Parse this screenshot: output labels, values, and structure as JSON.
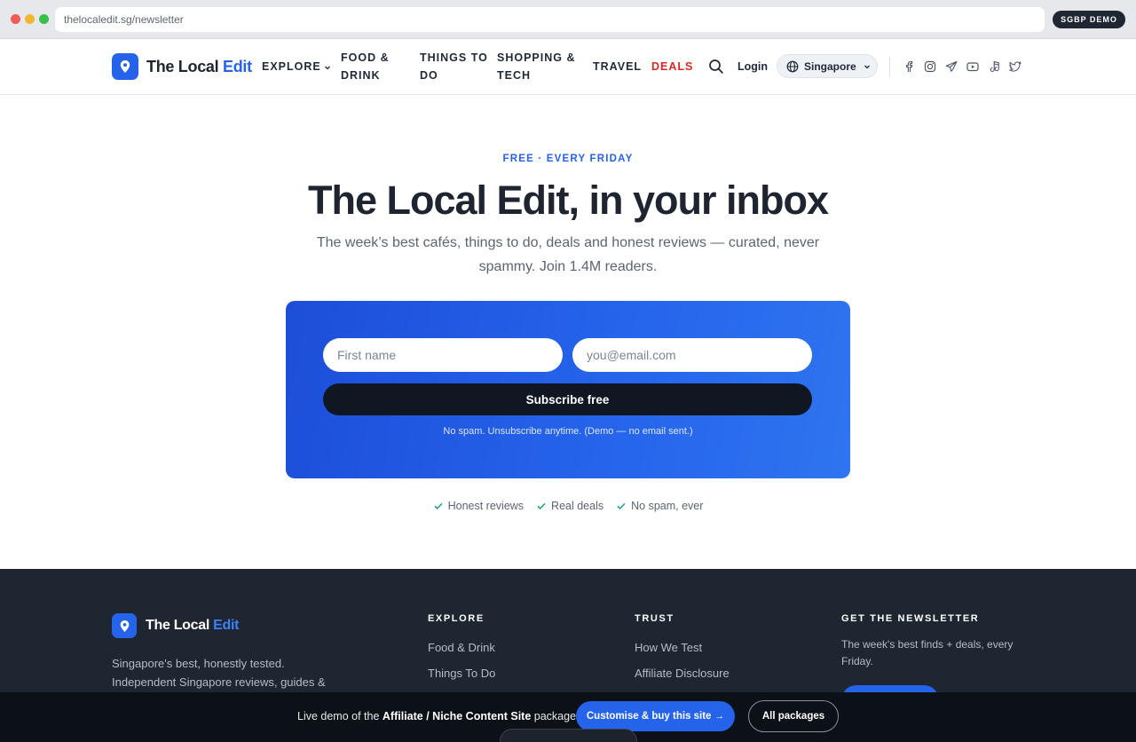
{
  "browser": {
    "url": "thelocaledit.sg/newsletter",
    "badge": "SGBP DEMO"
  },
  "brand": {
    "name_part1": "The Local",
    "name_part2": "Edit",
    "accent_color": "#2563eb"
  },
  "nav": {
    "items": [
      {
        "line1": "EXPLORE",
        "line2": "",
        "has_chevron": true
      },
      {
        "line1": "FOOD &",
        "line2": "DRINK"
      },
      {
        "line1": "THINGS TO",
        "line2": "DO"
      },
      {
        "line1": "SHOPPING &",
        "line2": "TECH"
      },
      {
        "line1": "TRAVEL",
        "line2": ""
      },
      {
        "line1": "DEALS",
        "line2": ""
      }
    ],
    "login": "Login",
    "region": "Singapore",
    "social_icons": [
      "facebook-icon",
      "instagram-icon",
      "telegram-icon",
      "youtube-icon",
      "tiktok-icon",
      "twitter-icon"
    ]
  },
  "hero": {
    "eyebrow": "FREE · EVERY FRIDAY",
    "title": "The Local Edit, in your inbox",
    "subtitle": "The week’s best cafés, things to do, deals and honest reviews — curated, never spammy. Join 1.4M readers."
  },
  "form": {
    "first_name_placeholder": "First name",
    "email_placeholder": "you@email.com",
    "submit_label": "Subscribe free",
    "note": "No spam. Unsubscribe anytime. (Demo — no email sent.)"
  },
  "trust_points": [
    "Honest reviews",
    "Real deals",
    "No spam, ever"
  ],
  "footer": {
    "description": "Singapore's best, honestly tested. Independent Singapore reviews, guides &",
    "explore_heading": "EXPLORE",
    "explore_links": [
      "Food & Drink",
      "Things To Do"
    ],
    "trust_heading": "TRUST",
    "trust_links": [
      "How We Test",
      "Affiliate Disclosure"
    ],
    "newsletter_heading": "GET THE NEWSLETTER",
    "newsletter_text": "The week's best finds + deals, every Friday."
  },
  "demo_bar": {
    "text_prefix": "Live demo of the",
    "package_name": "Affiliate / Niche Content Site",
    "text_suffix": "package.",
    "customise_label": "Customise & buy this site →",
    "packages_label": "All packages"
  }
}
